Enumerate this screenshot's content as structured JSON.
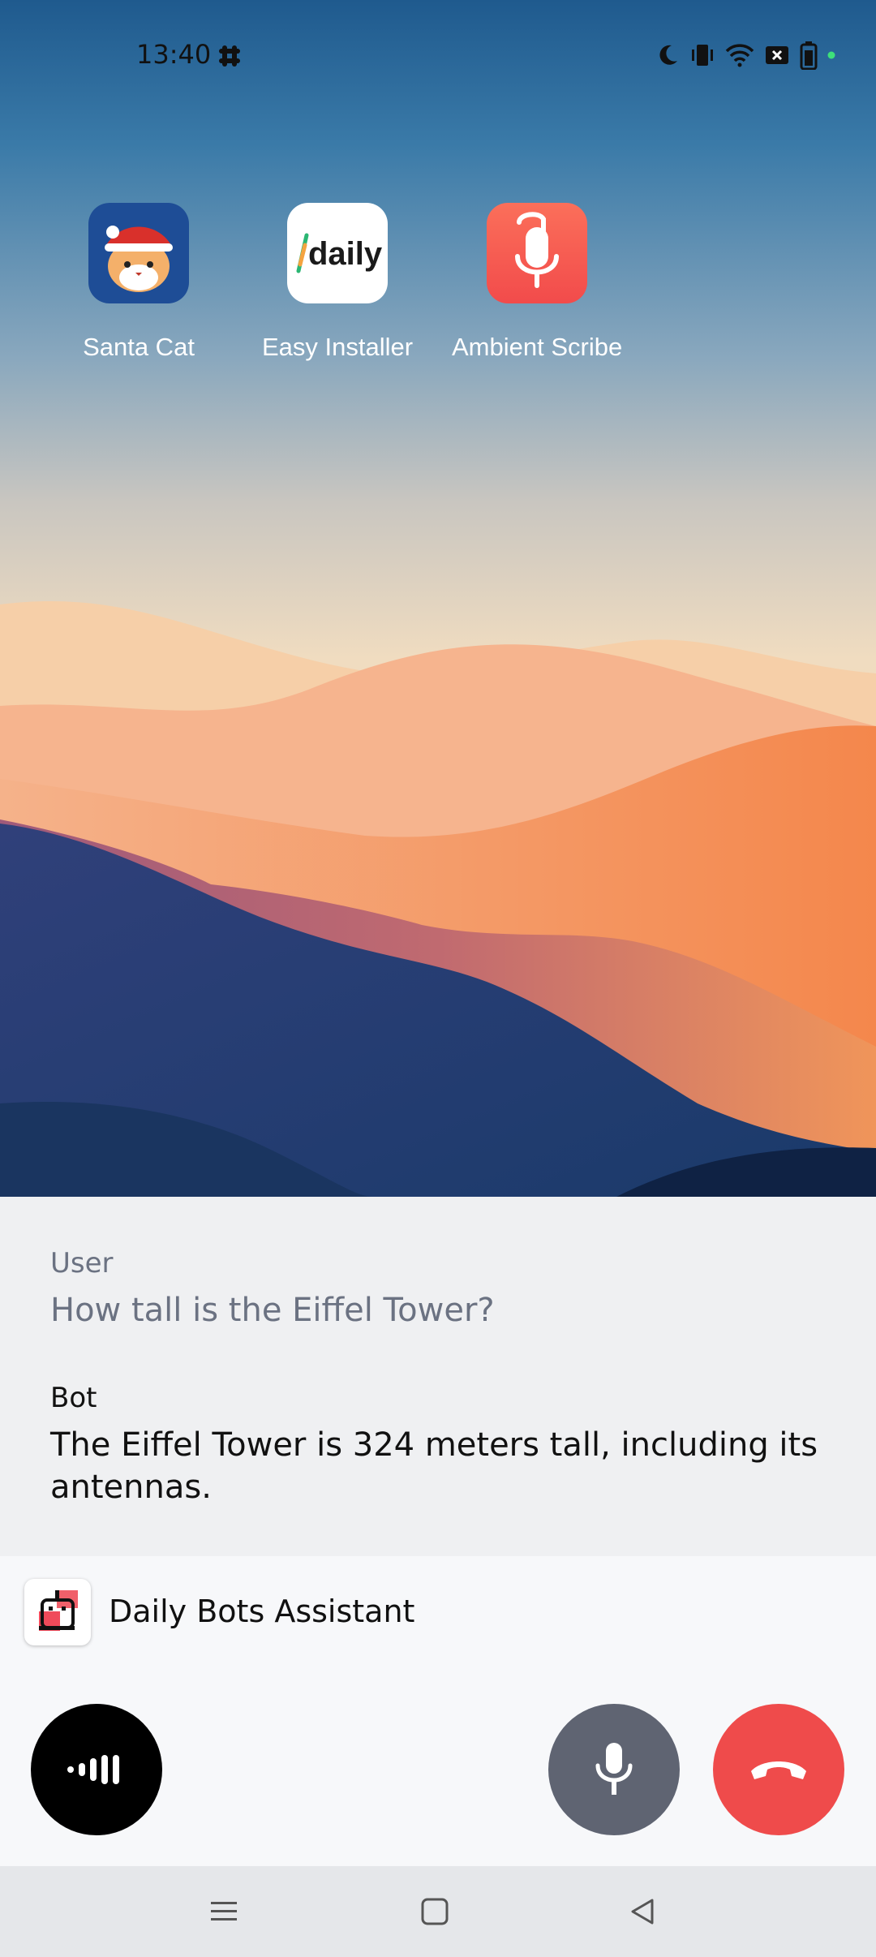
{
  "status_bar": {
    "time": "13:40",
    "icons": [
      "slack-icon",
      "moon-icon",
      "vibrate-icon",
      "wifi-icon",
      "no-sim-icon",
      "battery-icon",
      "green-dot-indicator"
    ]
  },
  "apps": [
    {
      "label": "Santa Cat",
      "icon": "santa-cat-icon"
    },
    {
      "label": "Easy Installer",
      "icon": "daily-logo-icon",
      "logo_text": "daily"
    },
    {
      "label": "Ambient Scribe",
      "icon": "microphone-clip-icon"
    }
  ],
  "transcript": {
    "user_label": "User",
    "user_message": "How tall is the Eiffel Tower?",
    "bot_label": "Bot",
    "bot_message": "The Eiffel Tower is 324 meters tall, including its antennas."
  },
  "assistant": {
    "name": "Daily Bots Assistant",
    "logo": "robot-logo-icon"
  },
  "controls": {
    "audio_button_icon": "audio-levels-icon",
    "mic_button_icon": "microphone-icon",
    "end_call_icon": "hang-up-icon"
  },
  "navigation": [
    "menu-icon",
    "home-square-icon",
    "back-triangle-icon"
  ],
  "colors": {
    "end_call": "#ef4b4b",
    "mic_button": "#5f6472",
    "audio_button": "#000000",
    "transcript_bg": "#eff0f2",
    "user_text": "#6b7282",
    "bot_text": "#111111"
  }
}
